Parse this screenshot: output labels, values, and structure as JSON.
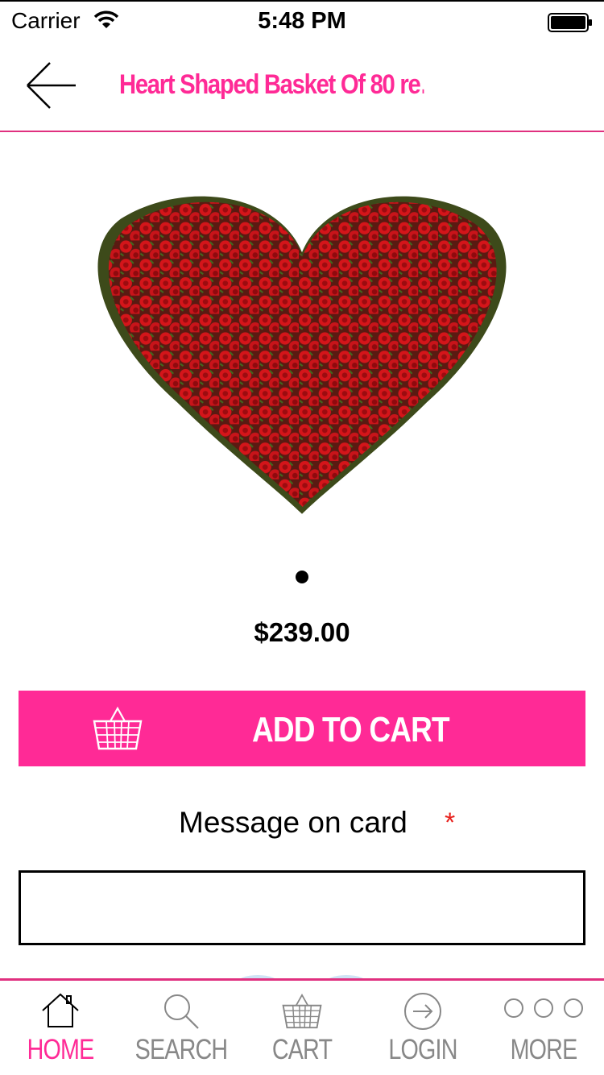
{
  "status_bar": {
    "carrier": "Carrier",
    "time": "5:48 PM"
  },
  "nav": {
    "title": "Heart Shaped Basket Of 80 re…"
  },
  "product": {
    "image_icon": "heart-rose-basket-image",
    "pager": {
      "current": 1,
      "total": 1
    },
    "price": "$239.00"
  },
  "actions": {
    "add_to_cart_label": "ADD TO CART"
  },
  "message": {
    "label": "Message on card",
    "required_mark": "*",
    "value": "",
    "placeholder": ""
  },
  "tabs": [
    {
      "label": "HOME",
      "icon": "home-icon",
      "active": true
    },
    {
      "label": "SEARCH",
      "icon": "search-icon",
      "active": false
    },
    {
      "label": "CART",
      "icon": "basket-icon",
      "active": false
    },
    {
      "label": "LOGIN",
      "icon": "login-icon",
      "active": false
    },
    {
      "label": "MORE",
      "icon": "more-icon",
      "active": false
    }
  ],
  "colors": {
    "accent": "#ff2a96",
    "divider": "#e0307f",
    "required": "#e8201c",
    "inactive_tab": "#888888"
  }
}
